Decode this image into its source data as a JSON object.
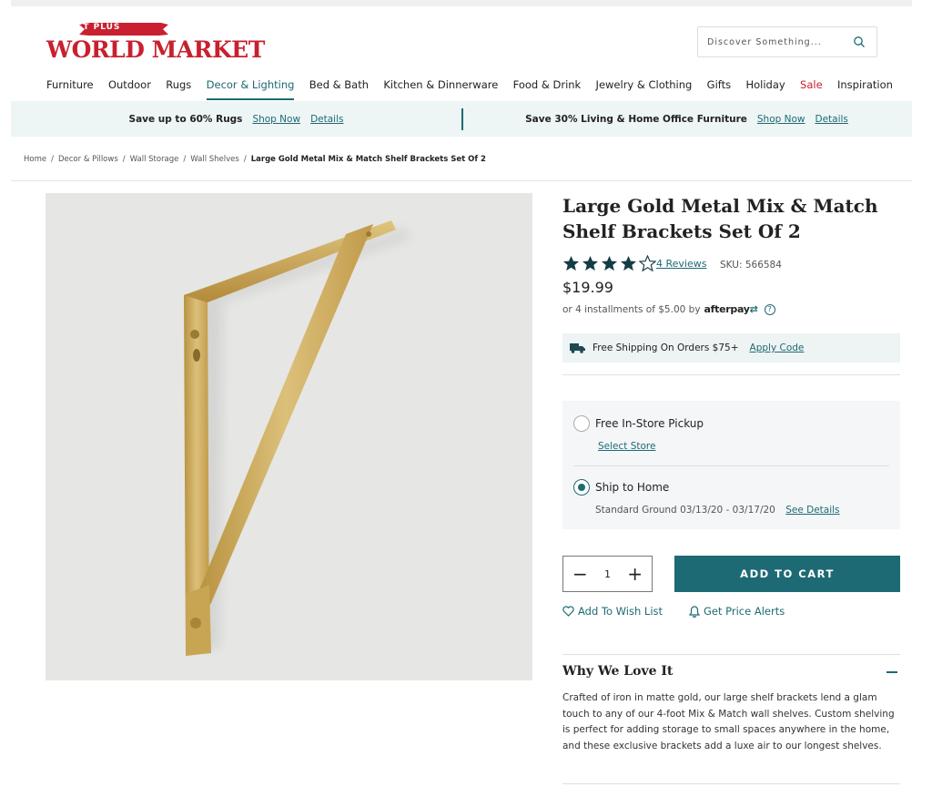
{
  "header": {
    "logo_banner": "COST PLUS",
    "logo_word": "WORLD MARKET",
    "search_placeholder": "Discover Something...",
    "brand_color": "#c8202f",
    "accent_color": "#1d6a74"
  },
  "nav": {
    "items": [
      {
        "label": "Furniture"
      },
      {
        "label": "Outdoor"
      },
      {
        "label": "Rugs"
      },
      {
        "label": "Decor & Lighting"
      },
      {
        "label": "Bed & Bath"
      },
      {
        "label": "Kitchen & Dinnerware"
      },
      {
        "label": "Food & Drink"
      },
      {
        "label": "Jewelry & Clothing"
      },
      {
        "label": "Gifts"
      },
      {
        "label": "Holiday"
      },
      {
        "label": "Sale"
      },
      {
        "label": "Inspiration"
      }
    ],
    "active": "Decor & Lighting"
  },
  "promo": {
    "left_text": "Save up to 60% Rugs",
    "left_shop": "Shop Now",
    "left_details": "Details",
    "right_text": "Save 30% Living & Home Office Furniture",
    "right_shop": "Shop Now",
    "right_details": "Details"
  },
  "breadcrumb": {
    "items": [
      "Home",
      "Decor & Pillows",
      "Wall Storage",
      "Wall Shelves"
    ],
    "separator": "/",
    "current": "Large Gold Metal Mix & Match Shelf Brackets Set Of 2"
  },
  "product": {
    "title": "Large Gold Metal Mix & Match Shelf Brackets Set Of 2",
    "rating_value": 4,
    "rating_max": 5,
    "reviews_label": "4 Reviews",
    "sku_label": "SKU: 566584",
    "price": "$19.99",
    "afterpay_text": "or 4 installments of $5.00 by",
    "afterpay_logo": "afterpay",
    "afterpay_help": "?",
    "image_icon": "gold-shelf-bracket"
  },
  "shipping": {
    "text": "Free Shipping On Orders $75+",
    "link": "Apply Code",
    "icon": "truck-icon"
  },
  "fulfillment": {
    "pickup_label": "Free In-Store Pickup",
    "select_store": "Select Store",
    "ship_label": "Ship to Home",
    "selected": "ship",
    "standard_text": "Standard Ground 03/13/20 - 03/17/20",
    "see_details": "See Details"
  },
  "cart": {
    "minus": "−",
    "plus": "+",
    "quantity": "1",
    "add_label": "ADD TO CART"
  },
  "actions": {
    "wishlist": "Add To Wish List",
    "price_alerts": "Get Price Alerts"
  },
  "why": {
    "title": "Why We Love It",
    "text": "Crafted of iron in matte gold, our large shelf brackets lend a glam touch to any of our 4-foot Mix & Match wall shelves. Custom shelving is perfect for adding storage to small spaces anywhere in the home, and these exclusive brackets add a luxe air to our longest shelves."
  }
}
